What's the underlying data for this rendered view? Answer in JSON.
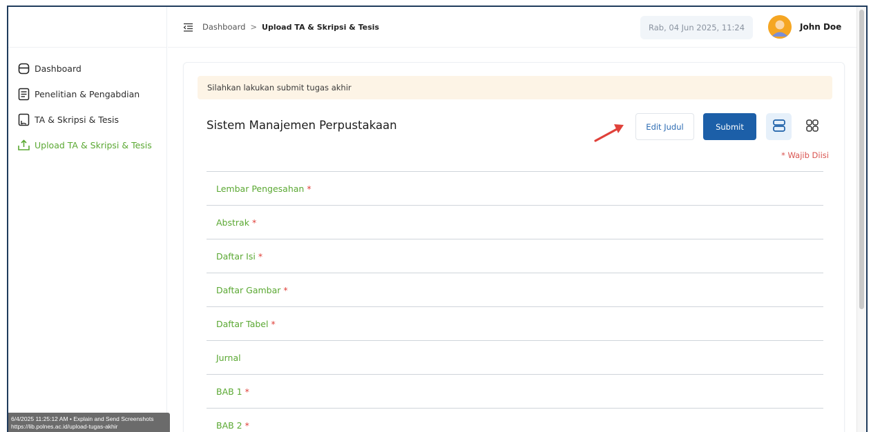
{
  "sidebar": {
    "items": [
      {
        "label": "Dashboard",
        "icon": "dashboard-icon",
        "active": false
      },
      {
        "label": "Penelitian & Pengabdian",
        "icon": "document-list-icon",
        "active": false
      },
      {
        "label": "TA & Skripsi & Tesis",
        "icon": "thesis-book-icon",
        "active": false
      },
      {
        "label": "Upload TA & Skripsi & Tesis",
        "icon": "upload-icon",
        "active": true
      }
    ]
  },
  "header": {
    "breadcrumb": [
      "Dashboard",
      "Upload TA & Skripsi & Tesis"
    ],
    "breadcrumb_separator": ">",
    "datetime": "Rab, 04 Jun 2025, 11:24",
    "username": "John Doe"
  },
  "main": {
    "notice": "Silahkan lakukan submit tugas akhir",
    "title": "Sistem Manajemen Perpustakaan",
    "edit_label": "Edit Judul",
    "submit_label": "Submit",
    "required_note": "* Wajib Diisi",
    "sections": [
      {
        "label": "Lembar Pengesahan",
        "required": true
      },
      {
        "label": "Abstrak",
        "required": true
      },
      {
        "label": "Daftar Isi",
        "required": true
      },
      {
        "label": "Daftar Gambar",
        "required": true
      },
      {
        "label": "Daftar Tabel",
        "required": true
      },
      {
        "label": "Jurnal",
        "required": false
      },
      {
        "label": "BAB 1",
        "required": true
      },
      {
        "label": "BAB 2",
        "required": true
      }
    ]
  },
  "screenshot_stamp": {
    "line1": "6/4/2025 11:25:12 AM • Explain and Send Screenshots",
    "line2": "https://lib.polnes.ac.id/upload-tugas-akhir"
  },
  "colors": {
    "accent_green": "#5aa832",
    "primary_blue": "#1c5fa8",
    "required_red": "#e0413a",
    "notice_bg": "#fdf4e6",
    "annotation_arrow": "#e0413a"
  }
}
